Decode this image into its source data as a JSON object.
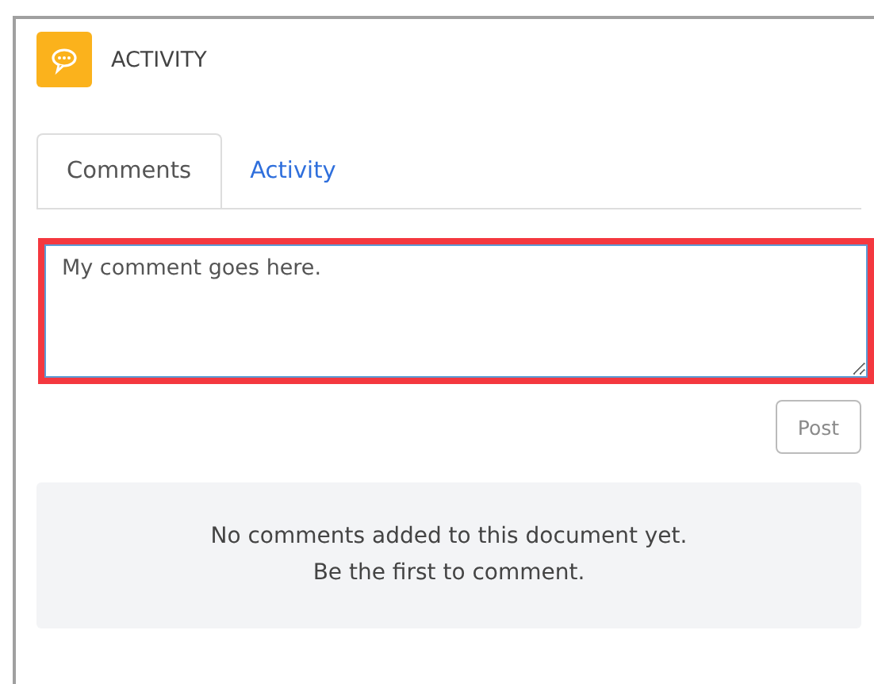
{
  "panel": {
    "title": "ACTIVITY"
  },
  "tabs": [
    {
      "label": "Comments",
      "selected": true
    },
    {
      "label": "Activity",
      "selected": false
    }
  ],
  "comment_field": {
    "value": "My comment goes here.",
    "highlighted": true
  },
  "post_button": {
    "label": "Post",
    "disabled": true
  },
  "empty_state": {
    "lines": [
      "No comments added to this document yet.",
      "Be the first to comment."
    ]
  }
}
